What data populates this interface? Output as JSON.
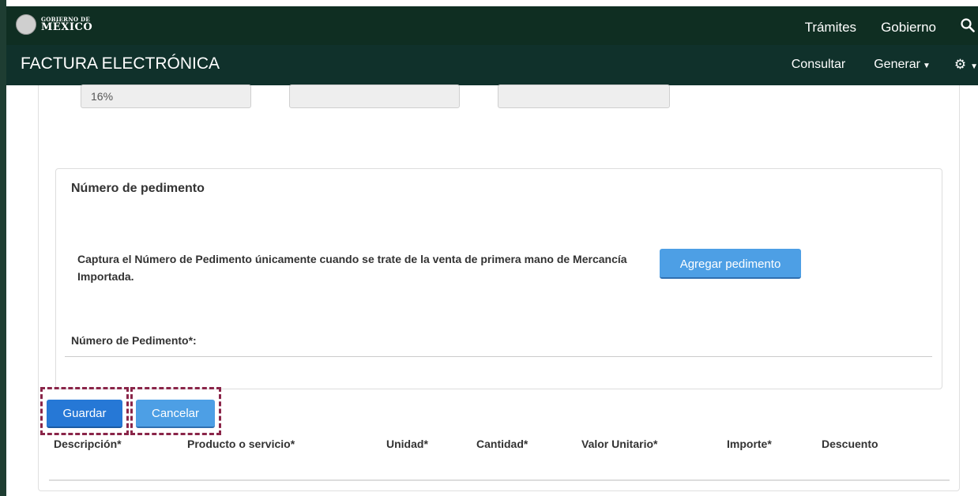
{
  "header": {
    "logo_top": "GOBIERNO DE",
    "logo_bottom": "MÉXICO",
    "nav": [
      "Trámites",
      "Gobierno"
    ],
    "search_icon": "search-icon"
  },
  "appbar": {
    "title": "FACTURA ELECTRÓNICA",
    "consultar": "Consultar",
    "generar": "Generar",
    "settings_icon": "gear-icon"
  },
  "tax_fields": [
    "16%",
    "",
    ""
  ],
  "pedimento": {
    "title": "Número de pedimento",
    "description": "Captura el Número de Pedimento únicamente cuando se trate de la venta de primera mano de Mercancía Importada.",
    "add_button": "Agregar pedimento",
    "field_label": "Número de Pedimento*:"
  },
  "actions": {
    "save": "Guardar",
    "cancel": "Cancelar"
  },
  "table": {
    "columns": [
      "Descripción*",
      "Producto o servicio*",
      "Unidad*",
      "Cantidad*",
      "Valor Unitario*",
      "Importe*",
      "Descuento"
    ]
  },
  "colors": {
    "gov_bar": "#0f2e22",
    "app_bar": "#10312b",
    "primary_button": "#2678d6",
    "info_button": "#4d9fe5",
    "highlight": "#8a2549"
  }
}
